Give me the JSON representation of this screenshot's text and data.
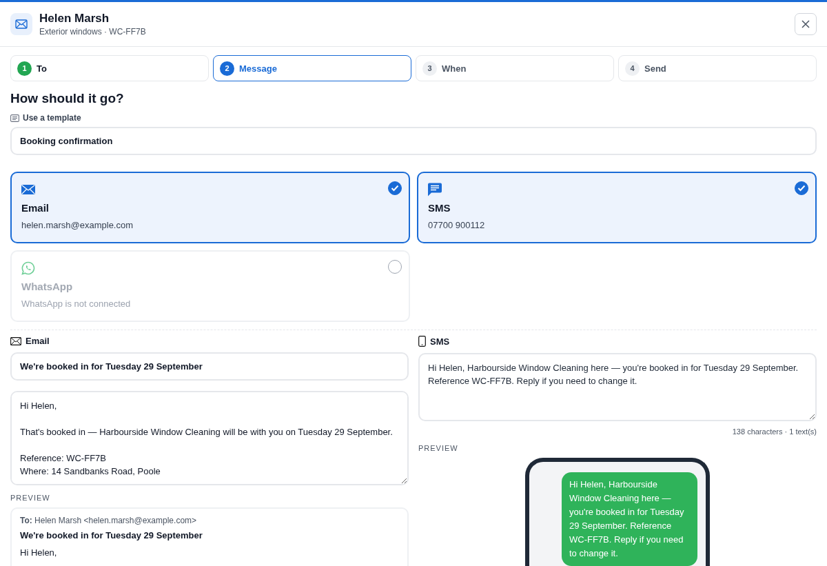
{
  "header": {
    "name": "Helen Marsh",
    "subtitle": "Exterior windows · WC-FF7B"
  },
  "steps": [
    {
      "number": "1",
      "label": "To",
      "completed": true,
      "selected": false
    },
    {
      "number": "2",
      "label": "Message",
      "completed": false,
      "selected": true
    },
    {
      "number": "3",
      "label": "When",
      "completed": false,
      "selected": false
    },
    {
      "number": "4",
      "label": "Send",
      "completed": false,
      "selected": false
    }
  ],
  "heading": "How should it go?",
  "template": {
    "label": "Use a template",
    "value": "Booking confirmation"
  },
  "channels": [
    {
      "kind": "email",
      "name": "Email",
      "detail": "helen.marsh@example.com",
      "selected": true,
      "disabled": false
    },
    {
      "kind": "sms",
      "name": "SMS",
      "detail": "07700 900112",
      "selected": true,
      "disabled": false
    },
    {
      "kind": "whatsapp",
      "name": "WhatsApp",
      "detail": "WhatsApp is not connected",
      "selected": false,
      "disabled": true
    }
  ],
  "email": {
    "title": "Email",
    "subject": "We're booked in for Tuesday 29 September",
    "body": "Hi Helen,\n\nThat's booked in — Harbourside Window Cleaning will be with you on Tuesday 29 September.\n\nReference: WC-FF7B\nWhere: 14 Sandbanks Road, Poole",
    "preview_label": "PREVIEW",
    "preview": {
      "to": "**To:** Helen Marsh <helen.marsh@example.com>",
      "subject": "We're booked in for Tuesday 29 September",
      "body": "Hi Helen,"
    }
  },
  "sms": {
    "title": "SMS",
    "text": "Hi Helen, Harbourside Window Cleaning here — you're booked in for Tuesday 29 September. Reference WC-FF7B. Reply if you need to change it.",
    "count": "138 characters · 1 text(s)",
    "preview_label": "PREVIEW",
    "bubble": "Hi Helen, Harbourside Window Cleaning here — you're booked in for Tuesday 29 September. Reference WC-FF7B. Reply if you need to change it."
  }
}
